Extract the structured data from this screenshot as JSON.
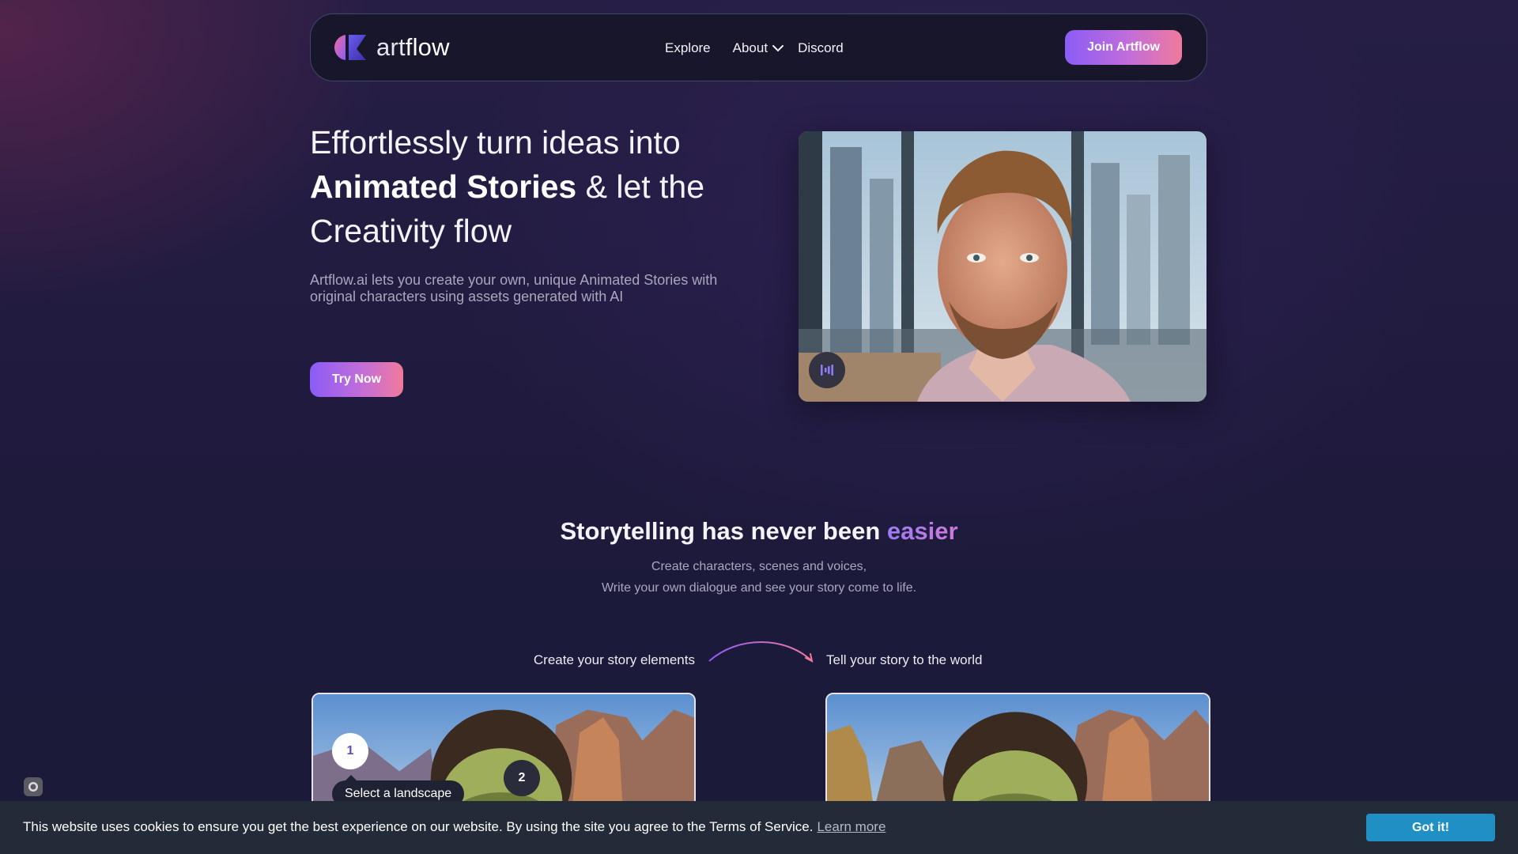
{
  "nav": {
    "logo_text_light": "art",
    "logo_text_bold": "flow",
    "links": [
      "Explore",
      "About",
      "Discord"
    ],
    "join_label": "Join Artflow"
  },
  "hero": {
    "title_part1": "Effortlessly turn ideas into",
    "title_bold": "Animated Stories",
    "title_part2": " & let the Creativity flow",
    "subtitle": "Artflow.ai lets you create your own, unique Animated Stories with original characters using assets generated with AI",
    "cta_label": "Try Now"
  },
  "section": {
    "title": "Storytelling has never been ",
    "title_accent": "easier",
    "line1": "Create characters, scenes and voices,",
    "line2": "Write your own dialogue and see your story come to life.",
    "flow_left": "Create your story elements",
    "flow_right": "Tell your story to the world",
    "step1": "1",
    "step2": "2",
    "tooltip": "Select a landscape"
  },
  "cookie": {
    "text": "This website uses cookies to ensure you get the best experience on our website. By using the site you agree to the Terms of Service.",
    "link": "Learn more",
    "button": "Got it!"
  },
  "colors": {
    "accent_start": "#8b5cf6",
    "accent_end": "#f07a9c",
    "cookie_button": "#1f8fc4"
  },
  "icons": {
    "logo": "artflow-logo-icon",
    "about_dropdown": "chevron-down-icon",
    "audio": "audio-wave-icon"
  }
}
